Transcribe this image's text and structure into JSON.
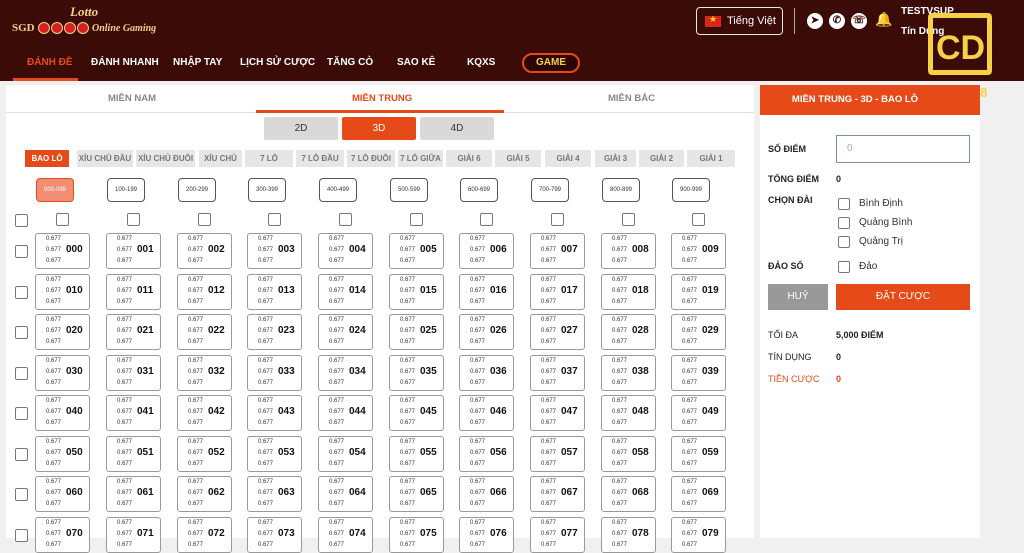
{
  "brand": {
    "line1": "Lotto",
    "line2a": "SGD",
    "line2b": "Online Gaming"
  },
  "header": {
    "language": "Tiếng Việt",
    "username": "TESTVSUP",
    "credit_label": "Tín Dụng"
  },
  "watermark": {
    "letters": "CD",
    "digits": "CD 6 8"
  },
  "nav": {
    "items": [
      "ĐÁNH ĐỀ",
      "ĐÁNH NHANH",
      "NHẬP TAY",
      "LỊCH SỬ CƯỢC",
      "TĂNG CÒ",
      "SAO KÊ",
      "KQXS"
    ],
    "game": "GAME",
    "active": 0
  },
  "regions": {
    "items": [
      "MIỀN NAM",
      "MIỀN TRUNG",
      "MIỀN BẮC"
    ],
    "active": 1
  },
  "digit_tabs": {
    "items": [
      "2D",
      "3D",
      "4D"
    ],
    "active": 1
  },
  "bet_types": {
    "items": [
      "BAO LÔ",
      "XỈU CHỦ ĐẦU",
      "XỈU CHỦ ĐUÔI",
      "XỈU CHỦ",
      "7 LÔ",
      "7 LÔ ĐẦU",
      "7 LÔ ĐUÔI",
      "7 LÔ GIỮA",
      "GIẢI 6",
      "GIẢI 5",
      "GIẢI 4",
      "GIẢI 3",
      "GIẢI 2",
      "GIẢI 1"
    ],
    "active": 0
  },
  "ranges": {
    "items": [
      "000-099",
      "100-199",
      "200-299",
      "300-399",
      "400-499",
      "500-599",
      "600-699",
      "700-799",
      "800-899",
      "900-999"
    ],
    "active": 0
  },
  "grid": {
    "odds": "0.677",
    "rows": 8,
    "cols": 10
  },
  "panel": {
    "title": "MIỀN TRUNG - 3D - BAO LÔ",
    "so_diem_label": "SỐ ĐIỂM",
    "so_diem_placeholder": "0",
    "tong_diem_label": "TỔNG ĐIỂM",
    "tong_diem_value": "0",
    "chon_dai_label": "CHỌN ĐÀI",
    "stations": [
      "Bình Định",
      "Quảng Bình",
      "Quảng Trị"
    ],
    "dao_so_label": "ĐẢO SỐ",
    "dao_option": "Đảo",
    "cancel": "HUỶ",
    "place_bet": "ĐẶT CƯỢC",
    "toi_da_label": "TỐI ĐA",
    "toi_da_value": "5,000 ĐIỂM",
    "tin_dung_label": "TÍN DỤNG",
    "tin_dung_value": "0",
    "tien_cuoc_label": "TIỀN CƯỢC",
    "tien_cuoc_value": "0"
  },
  "colors": {
    "primary": "#e64a19",
    "topbar": "#3b0b08",
    "gold": "#f7d046"
  }
}
